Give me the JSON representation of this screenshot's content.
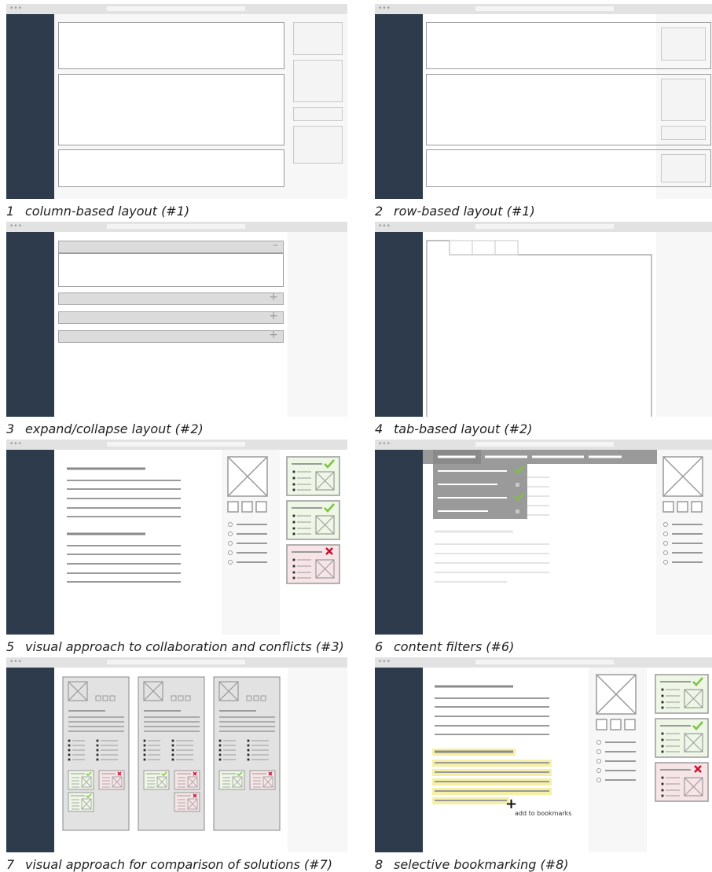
{
  "window": {
    "dots": "•••"
  },
  "captions": [
    {
      "num": "1",
      "text": "column-based layout (#1)"
    },
    {
      "num": "2",
      "text": "row-based layout (#1)"
    },
    {
      "num": "3",
      "text": "expand/collapse layout (#2)"
    },
    {
      "num": "4",
      "text": "tab-based layout (#2)"
    },
    {
      "num": "5",
      "text": "visual approach to collaboration and conflicts (#3)"
    },
    {
      "num": "6",
      "text": "content filters (#6)"
    },
    {
      "num": "7",
      "text": "visual approach for comparison of solutions (#7)"
    },
    {
      "num": "8",
      "text": "selective bookmarking (#8)"
    }
  ],
  "accordion": {
    "collapse_sign": "–",
    "expand_sign": "+"
  },
  "bookmark": {
    "plus": "+",
    "label": "add to bookmarks"
  },
  "colors": {
    "sidebar": "#2d3b4c",
    "accept": "#7dc242",
    "reject": "#c8102e",
    "highlight": "#f5f0a6",
    "accept_card": "#eef6e6",
    "reject_card": "#f6e4e6",
    "filter_menu": "#9a9a9a"
  },
  "icons": [
    "image-placeholder-icon",
    "check-icon",
    "cross-icon",
    "bullet-icon"
  ]
}
